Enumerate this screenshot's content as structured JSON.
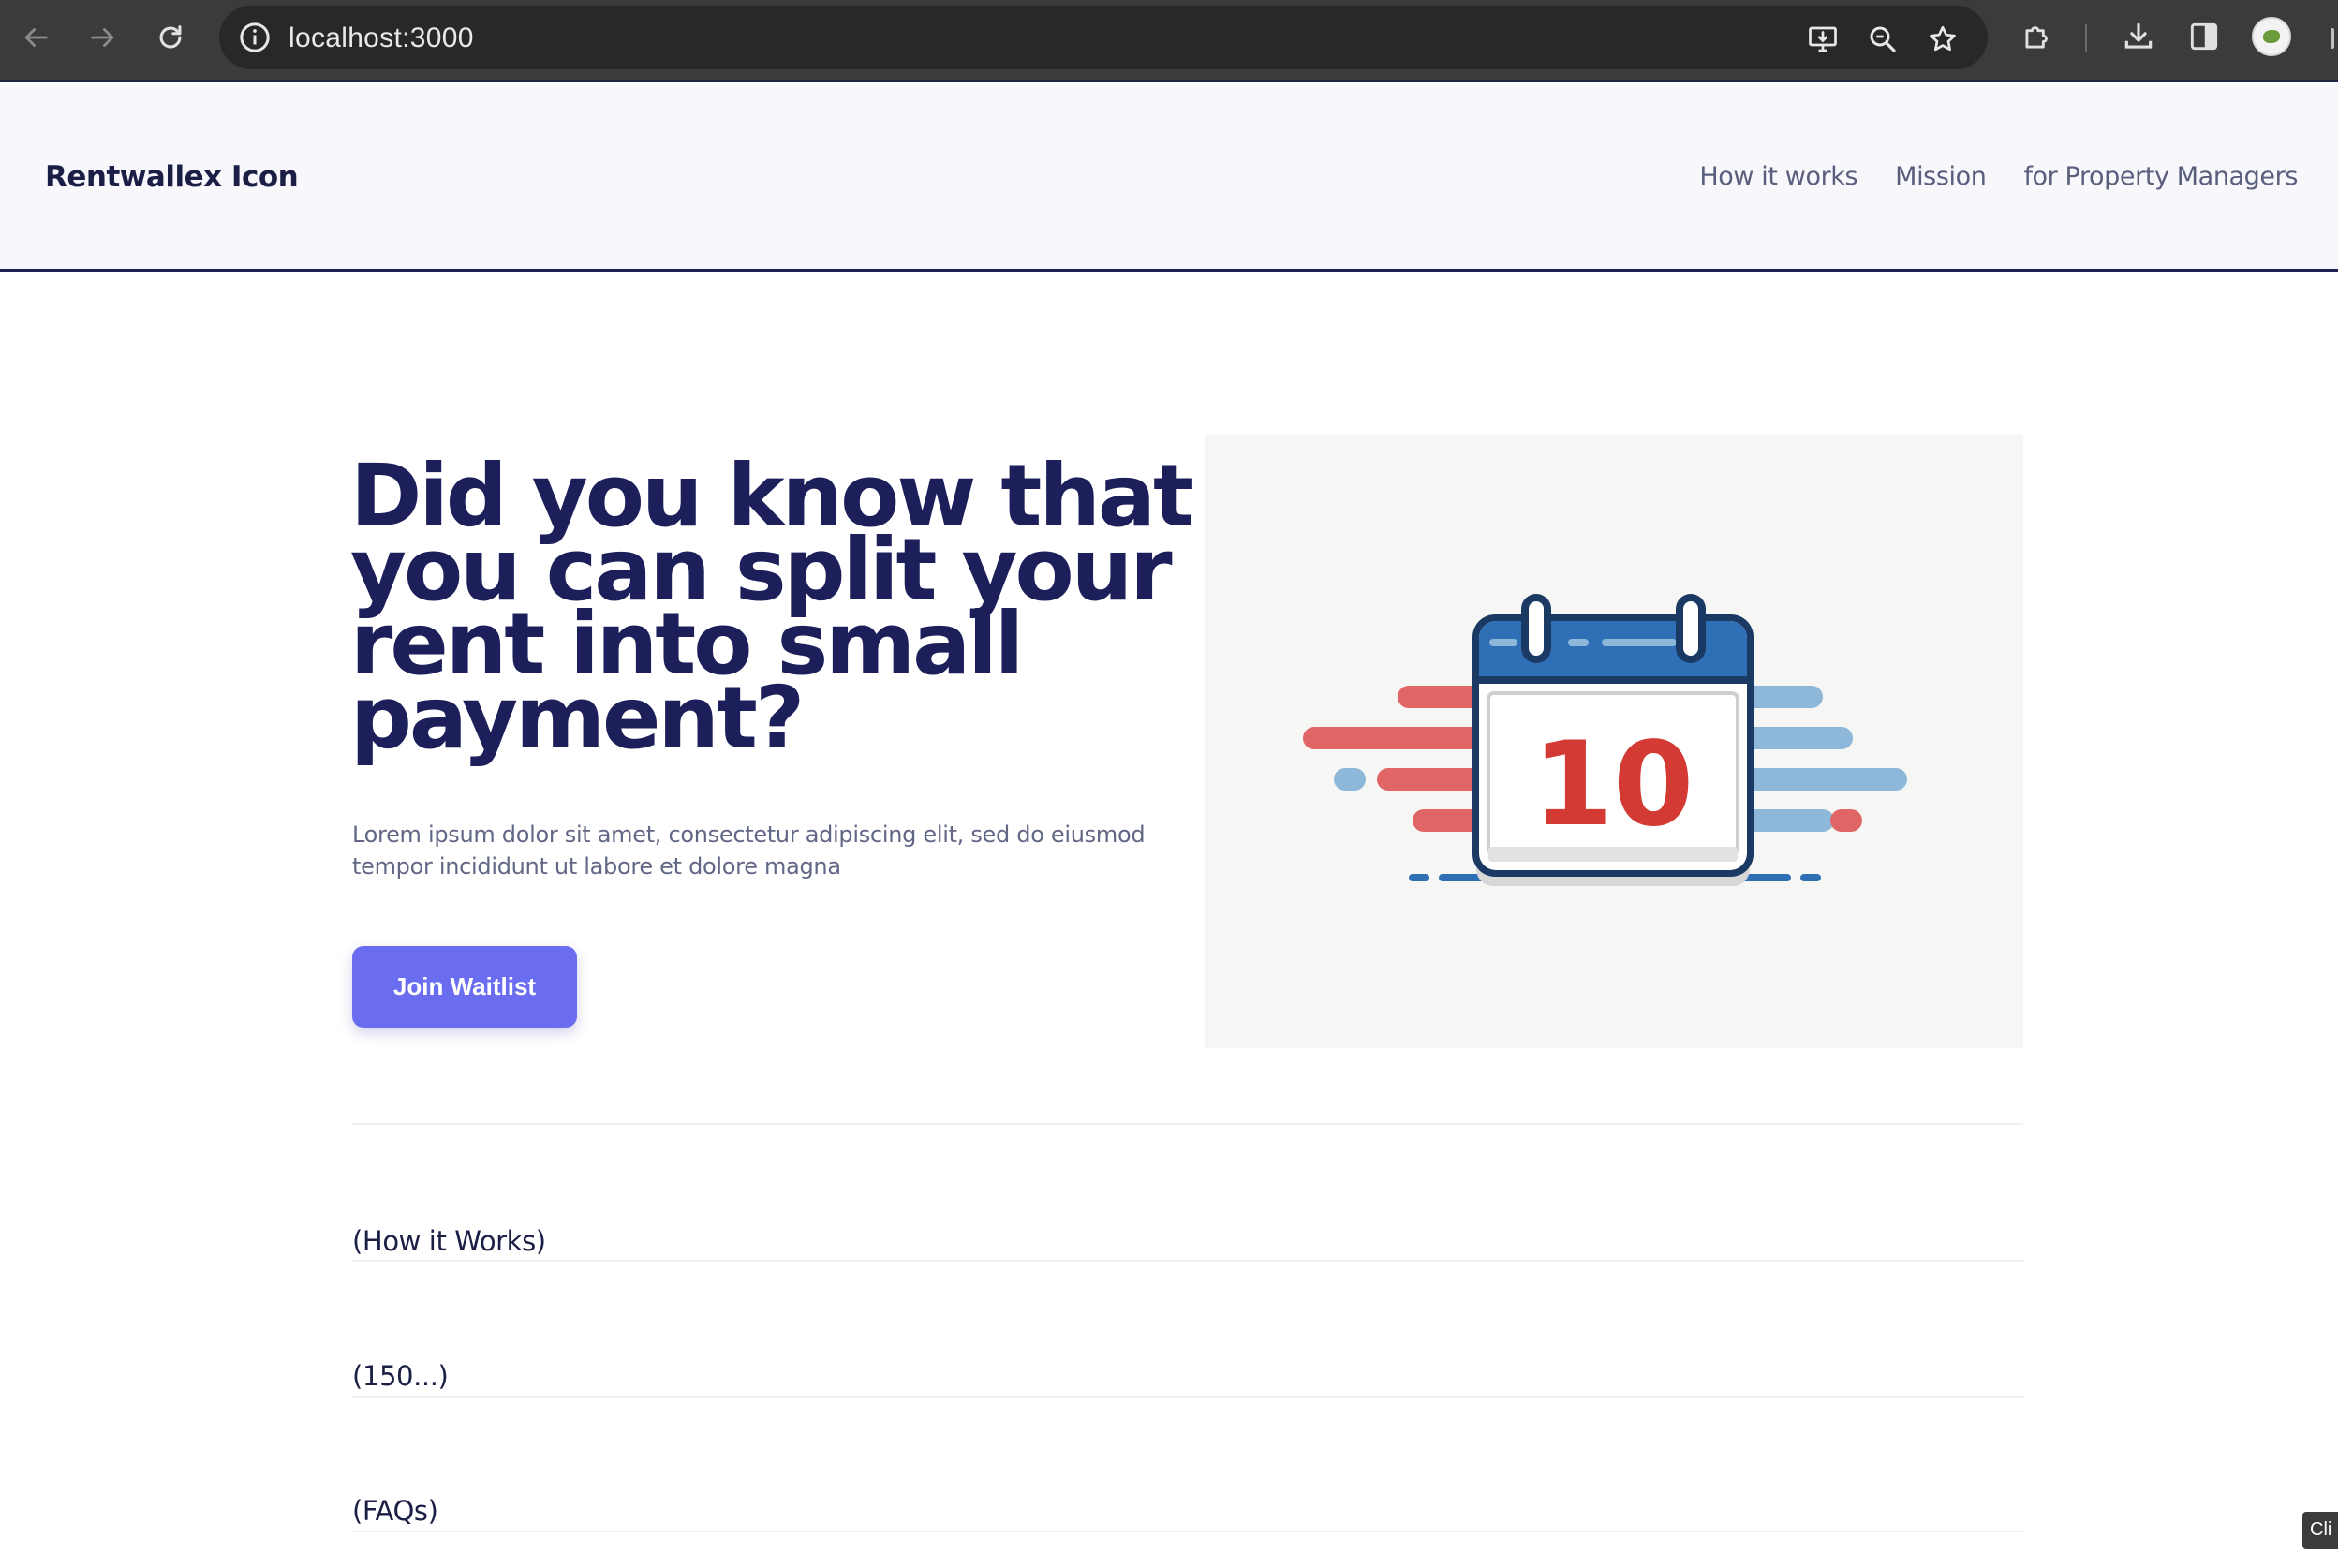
{
  "browser": {
    "url": "localhost:3000",
    "icons": [
      "back-arrow-icon",
      "forward-arrow-icon",
      "reload-icon",
      "site-info-icon",
      "install-app-icon",
      "zoom-icon",
      "bookmark-star-icon",
      "extensions-icon",
      "download-icon",
      "side-panel-icon",
      "profile-avatar"
    ]
  },
  "header": {
    "brand": "Rentwallex Icon",
    "nav": [
      "How it works",
      "Mission",
      "for Property Managers"
    ]
  },
  "hero": {
    "title": "Did you know that you can split your rent into small payment?",
    "subtitle": "Lorem ipsum dolor sit amet, consectetur adipiscing elit, sed do eiusmod tempor incididunt ut labore et dolore magna",
    "cta_label": "Join Waitlist",
    "illustration": {
      "calendar_day": "10",
      "colors": {
        "left_streaks": "#e06666",
        "right_streaks": "#8db8da",
        "calendar_header": "#2f6fb6",
        "calendar_outline": "#1b3a63",
        "day_number": "#d33a33"
      }
    }
  },
  "sections": [
    "(How it Works)",
    "(150...)",
    "(FAQs)"
  ],
  "tooltip_stub": "Cli",
  "colors": {
    "brand_dark": "#1d1f5a",
    "accent": "#6b6df0",
    "muted_text": "#626785"
  }
}
